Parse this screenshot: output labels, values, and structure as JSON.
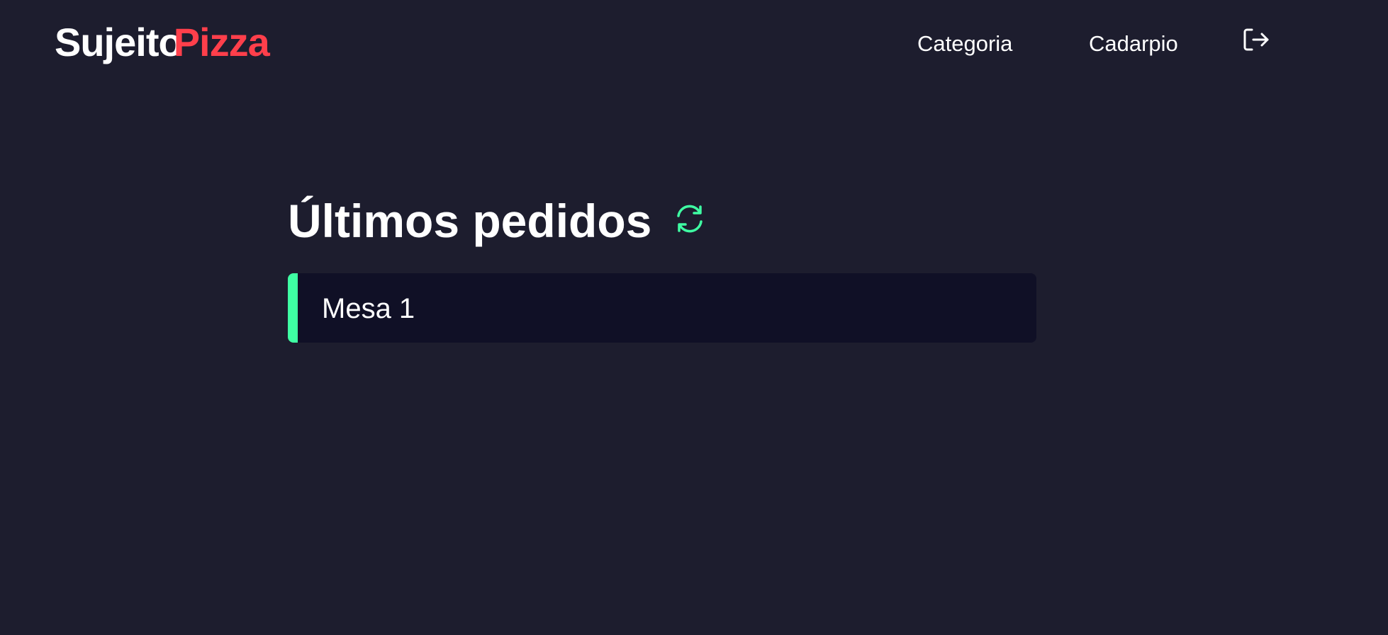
{
  "header": {
    "logo": {
      "part1": "Sujeito",
      "part2": "Pizza"
    },
    "nav": {
      "categoria": "Categoria",
      "cardapio": "Cadarpio"
    },
    "logout_icon": "logout-icon"
  },
  "main": {
    "title": "Últimos pedidos",
    "refresh_icon": "refresh-icon",
    "orders": [
      {
        "label": "Mesa 1"
      }
    ]
  },
  "colors": {
    "background": "#1d1d2e",
    "order_background": "#101026",
    "brand_red": "#ff3f4b",
    "accent_green": "#3fffa3",
    "text": "#ffffff"
  }
}
